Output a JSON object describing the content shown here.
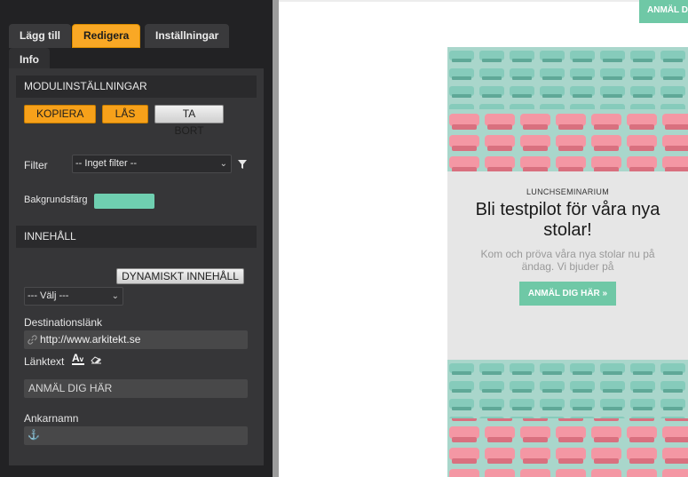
{
  "tabs": [
    {
      "label": "Lägg till"
    },
    {
      "label": "Redigera"
    },
    {
      "label": "Inställningar"
    },
    {
      "label": "Info"
    }
  ],
  "module_settings": {
    "header": "MODULINSTÄLLNINGAR",
    "copy_label": "KOPIERA",
    "lock_label": "LÅS",
    "delete_label": "TA BORT"
  },
  "filter": {
    "label": "Filter",
    "value": "-- Inget filter --"
  },
  "background": {
    "label": "Bakgrundsfärg",
    "color": "#6fcfb0"
  },
  "content": {
    "header": "INNEHÅLL",
    "dynamic_label": "DYNAMISKT INNEHÅLL",
    "choose_value": "--- Välj ---",
    "destination_label": "Destinationslänk",
    "destination_value": "http://www.arkitekt.se",
    "linktext_label": "Länktext",
    "linktext_value": "ANMÄL DIG HÄR",
    "anchor_label": "Ankarnamn",
    "anchor_value": ""
  },
  "preview": {
    "top_cta": "ANMÄL DIG HÄR",
    "eyebrow": "LUNCHSEMINARIUM",
    "title": "Bli testpilot för våra nya stolar!",
    "body": "Kom och pröva våra nya stolar nu på ändag. Vi bjuder på",
    "cta_label": "ANMÄL DIG HÄR »"
  },
  "colors": {
    "accent_orange": "#f7a11a",
    "panel_bg": "#222224",
    "cta_green": "#6fc8a6",
    "seat_pink": "#f08a9a",
    "seat_teal": "#7cc6b4"
  }
}
